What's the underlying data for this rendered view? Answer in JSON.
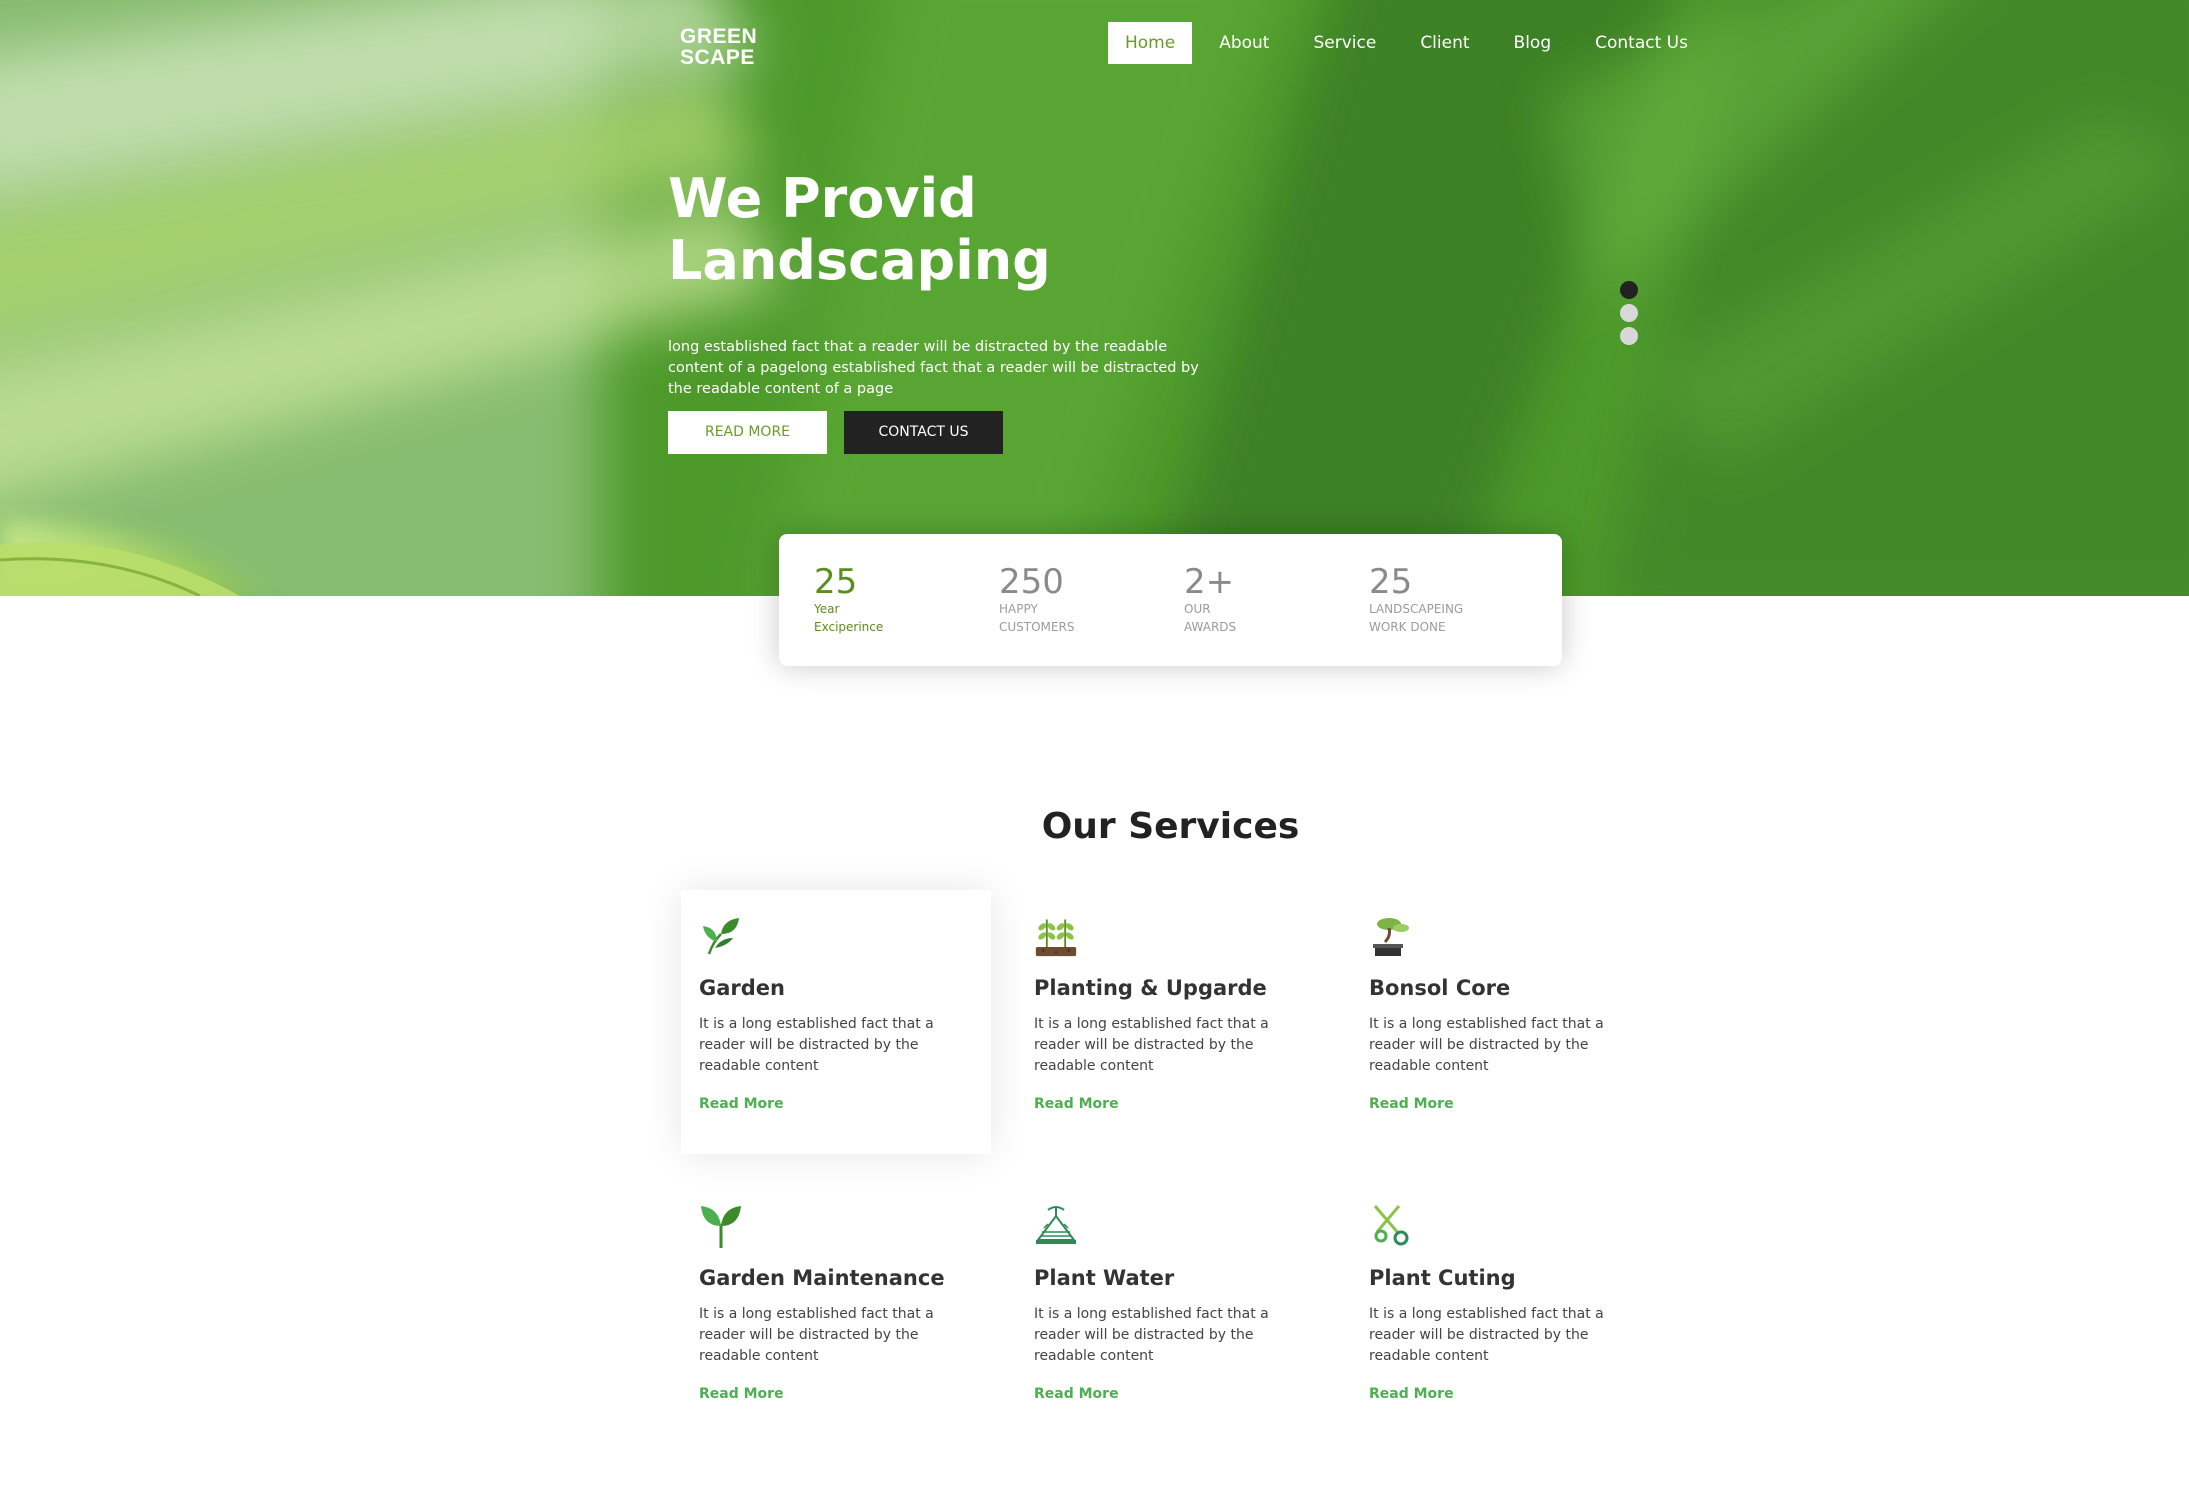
{
  "header": {
    "logo_line1": "GREEN",
    "logo_line2": "SCAPE",
    "nav": [
      "Home",
      "About",
      "Service",
      "Client",
      "Blog",
      "Contact Us"
    ]
  },
  "hero": {
    "title_line1": "We Provid",
    "title_line2": "Landscaping",
    "text": "long established fact that a reader will be distracted by the readable content of a pagelong established fact that a reader will be distracted by the readable content of a page",
    "read_more": "READ MORE",
    "contact_us": "CONTACT US",
    "slider_dots": 3,
    "active_dot": 1
  },
  "stats": [
    {
      "value": "25",
      "label_line1": "Year",
      "label_line2": "Exciperince"
    },
    {
      "value": "250",
      "label_line1": "HAPPY",
      "label_line2": "CUSTOMERS"
    },
    {
      "value": "2+",
      "label_line1": "OUR",
      "label_line2": "AWARDS"
    },
    {
      "value": "25",
      "label_line1": "LANDSCAPEING",
      "label_line2": "WORK DONE"
    }
  ],
  "services": {
    "title": "Our Services",
    "items": [
      {
        "title": "Garden",
        "text": "It is a long established fact that a reader will be distracted by the readable content",
        "link": "Read More",
        "icon": "sprout-icon"
      },
      {
        "title": "Planting & Upgarde",
        "text": "It is a long established fact that a reader will be distracted by the readable content",
        "link": "Read More",
        "icon": "plants-in-soil-icon"
      },
      {
        "title": "Bonsol Core",
        "text": "It is a long established fact that a reader will be distracted by the readable content",
        "link": "Read More",
        "icon": "bonsai-icon"
      },
      {
        "title": "Garden Maintenance",
        "text": "It is a long established fact that a reader will be distracted by the readable content",
        "link": "Read More",
        "icon": "seedling-icon"
      },
      {
        "title": "Plant Water",
        "text": "It is a long established fact that a reader will be distracted by the readable content",
        "link": "Read More",
        "icon": "watering-icon"
      },
      {
        "title": "Plant Cuting",
        "text": "It is a long established fact that a reader will be distracted by the readable content",
        "link": "Read More",
        "icon": "scissors-icon"
      }
    ]
  },
  "colors": {
    "accent": "#6a9b25",
    "link": "#4caf50",
    "dark": "#222222"
  }
}
